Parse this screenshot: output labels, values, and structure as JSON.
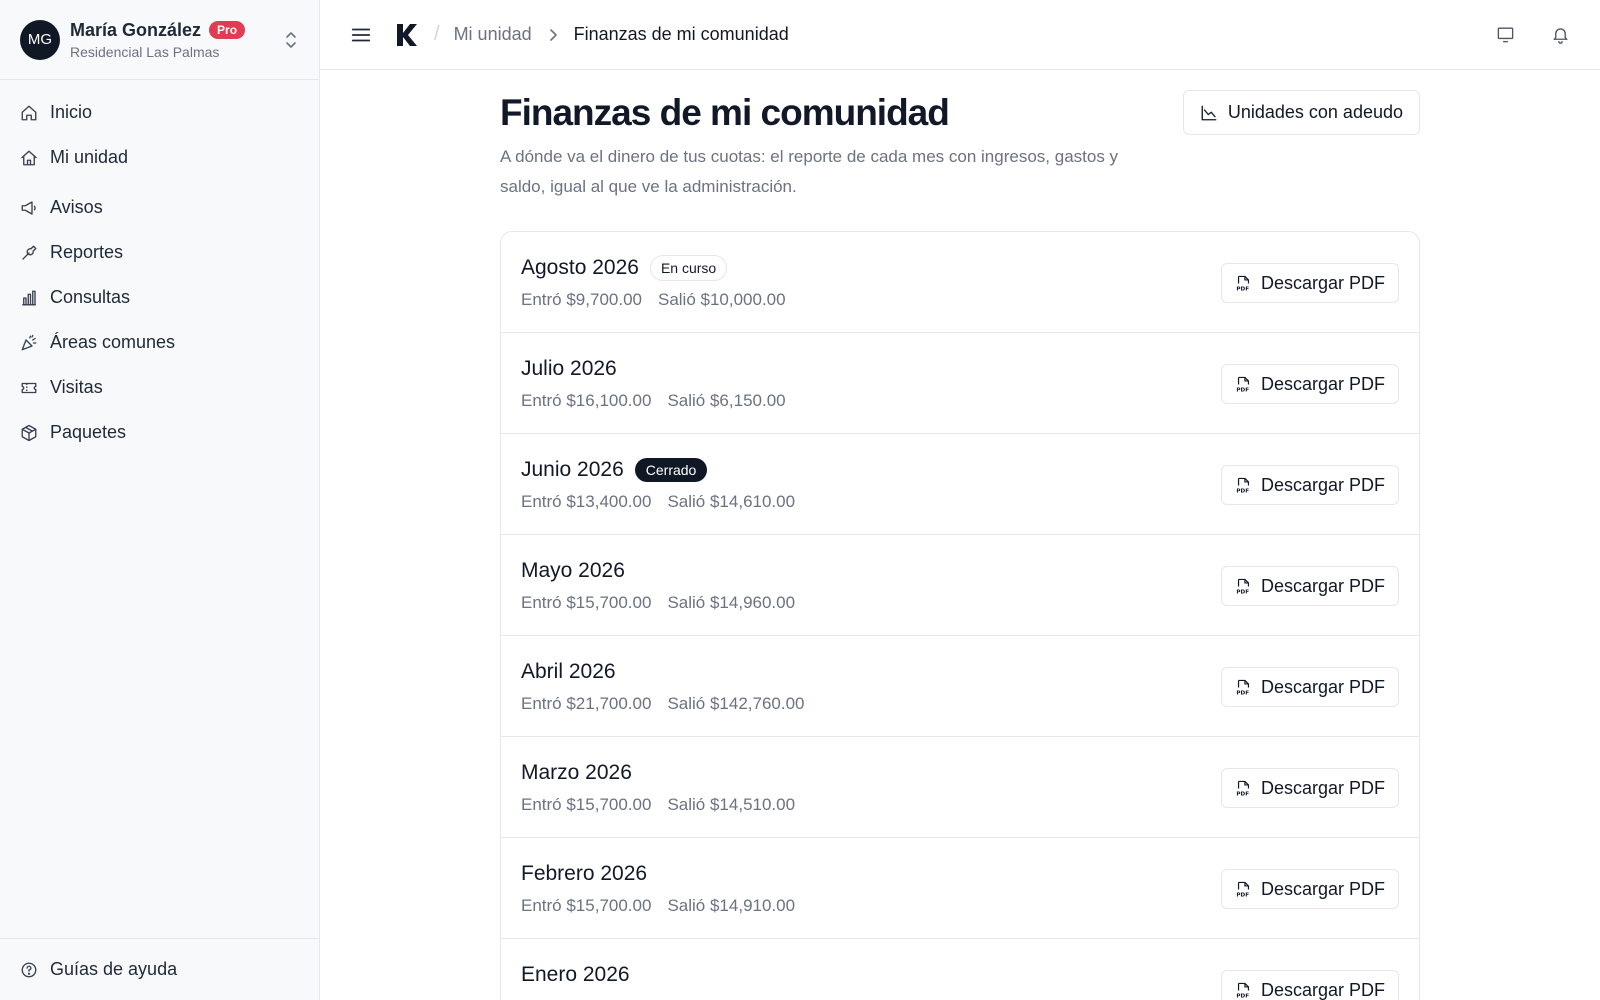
{
  "user": {
    "initials": "MG",
    "name": "María González",
    "badge": "Pro",
    "community": "Residencial Las Palmas"
  },
  "sidebar": {
    "items": [
      {
        "label": "Inicio",
        "icon": "home-icon"
      },
      {
        "label": "Mi unidad",
        "icon": "house-icon"
      },
      {
        "label": "Avisos",
        "icon": "megaphone-icon"
      },
      {
        "label": "Reportes",
        "icon": "wrench-icon"
      },
      {
        "label": "Consultas",
        "icon": "bar-chart-icon"
      },
      {
        "label": "Áreas comunes",
        "icon": "party-icon"
      },
      {
        "label": "Visitas",
        "icon": "ticket-icon"
      },
      {
        "label": "Paquetes",
        "icon": "package-icon"
      }
    ],
    "footer_label": "Guías de ayuda"
  },
  "breadcrumb": {
    "parent": "Mi unidad",
    "current": "Finanzas de mi comunidad"
  },
  "page": {
    "title": "Finanzas de mi comunidad",
    "description": "A dónde va el dinero de tus cuotas: el reporte de cada mes con ingresos, gastos y saldo, igual al que ve la administración.",
    "debt_button_label": "Unidades con adeudo"
  },
  "reports": [
    {
      "month": "Agosto 2026",
      "status": "En curso",
      "income": "Entró $9,700.00",
      "expense": "Salió $10,000.00",
      "button": "Descargar PDF"
    },
    {
      "month": "Julio 2026",
      "status": "",
      "income": "Entró $16,100.00",
      "expense": "Salió $6,150.00",
      "button": "Descargar PDF"
    },
    {
      "month": "Junio 2026",
      "status": "Cerrado",
      "income": "Entró $13,400.00",
      "expense": "Salió $14,610.00",
      "button": "Descargar PDF"
    },
    {
      "month": "Mayo 2026",
      "status": "",
      "income": "Entró $15,700.00",
      "expense": "Salió $14,960.00",
      "button": "Descargar PDF"
    },
    {
      "month": "Abril 2026",
      "status": "",
      "income": "Entró $21,700.00",
      "expense": "Salió $142,760.00",
      "button": "Descargar PDF"
    },
    {
      "month": "Marzo 2026",
      "status": "",
      "income": "Entró $15,700.00",
      "expense": "Salió $14,510.00",
      "button": "Descargar PDF"
    },
    {
      "month": "Febrero 2026",
      "status": "",
      "income": "Entró $15,700.00",
      "expense": "Salió $14,910.00",
      "button": "Descargar PDF"
    },
    {
      "month": "Enero 2026",
      "status": "",
      "income": "",
      "expense": "",
      "button": "Descargar PDF"
    }
  ],
  "colors": {
    "pro_badge": "#e23b54",
    "dark": "#101826",
    "muted_text": "#6b7280",
    "border": "#e5e7eb",
    "sidebar_bg": "#f8f9fb"
  }
}
